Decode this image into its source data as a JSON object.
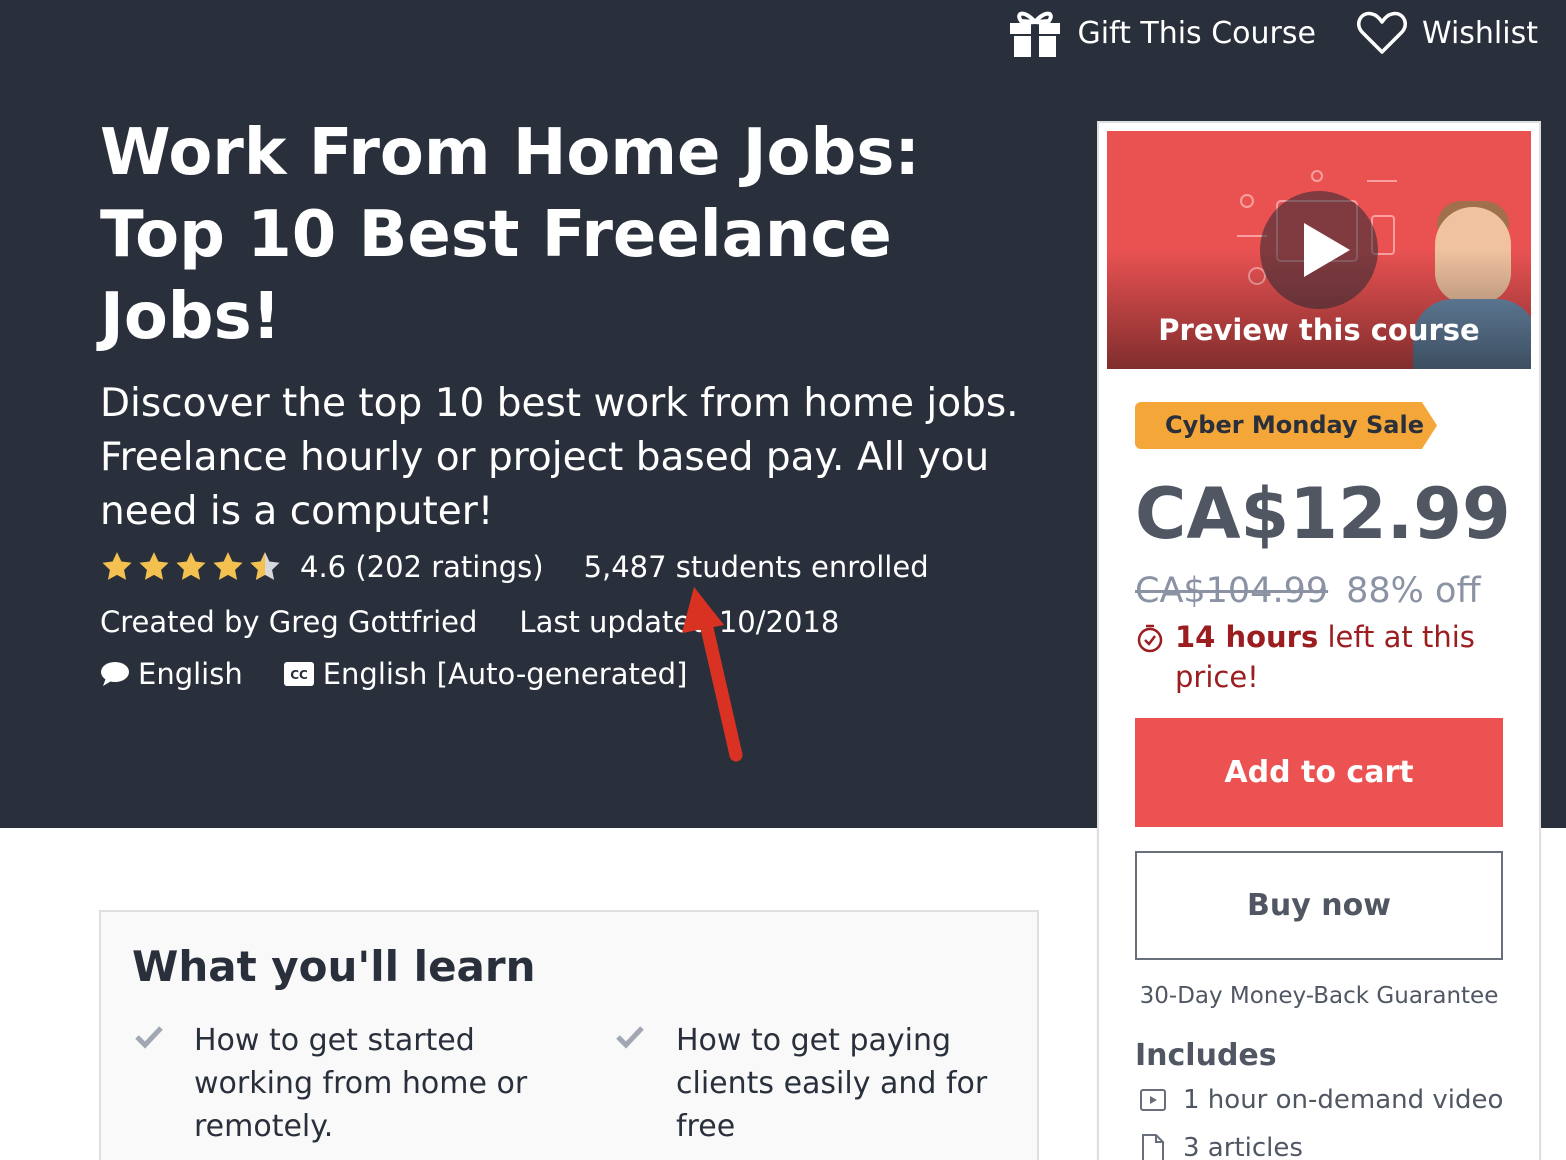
{
  "topbar": {
    "gift_label": "Gift This Course",
    "wishlist_label": "Wishlist"
  },
  "course": {
    "title": "Work From Home Jobs: Top 10 Best Freelance Jobs!",
    "subtitle": "Discover the top 10 best work from home jobs. Freelance hourly or project based pay. All you need is a computer!",
    "rating_value": 4.6,
    "rating_text": "4.6 (202 ratings)",
    "students": "5,487 students enrolled",
    "created_by": "Created by Greg Gottfried",
    "last_updated": "Last updated 10/2018",
    "language": "English",
    "captions": "English [Auto-generated]"
  },
  "sidebar": {
    "preview_label": "Preview this course",
    "sale_badge": "Cyber Monday Sale",
    "price": "CA$12.99",
    "original_price": "CA$104.99",
    "discount": "88% off",
    "timer_bold": "14 hours",
    "timer_rest": " left at this price!",
    "add_to_cart": "Add to cart",
    "buy_now": "Buy now",
    "guarantee": "30-Day Money-Back Guarantee",
    "includes_heading": "Includes",
    "includes": [
      {
        "icon": "video-icon",
        "label": "1 hour on-demand video"
      },
      {
        "icon": "article-icon",
        "label": "3 articles"
      }
    ]
  },
  "learn": {
    "heading": "What you'll learn",
    "items": [
      "How to get started working from home or remotely.",
      "How to get paying clients easily and for free"
    ]
  },
  "colors": {
    "hero_bg": "#29303b",
    "accent_red": "#ec5252",
    "star_yellow": "#f4c150",
    "badge_orange": "#f4a638",
    "timer_red": "#9b1d20"
  }
}
